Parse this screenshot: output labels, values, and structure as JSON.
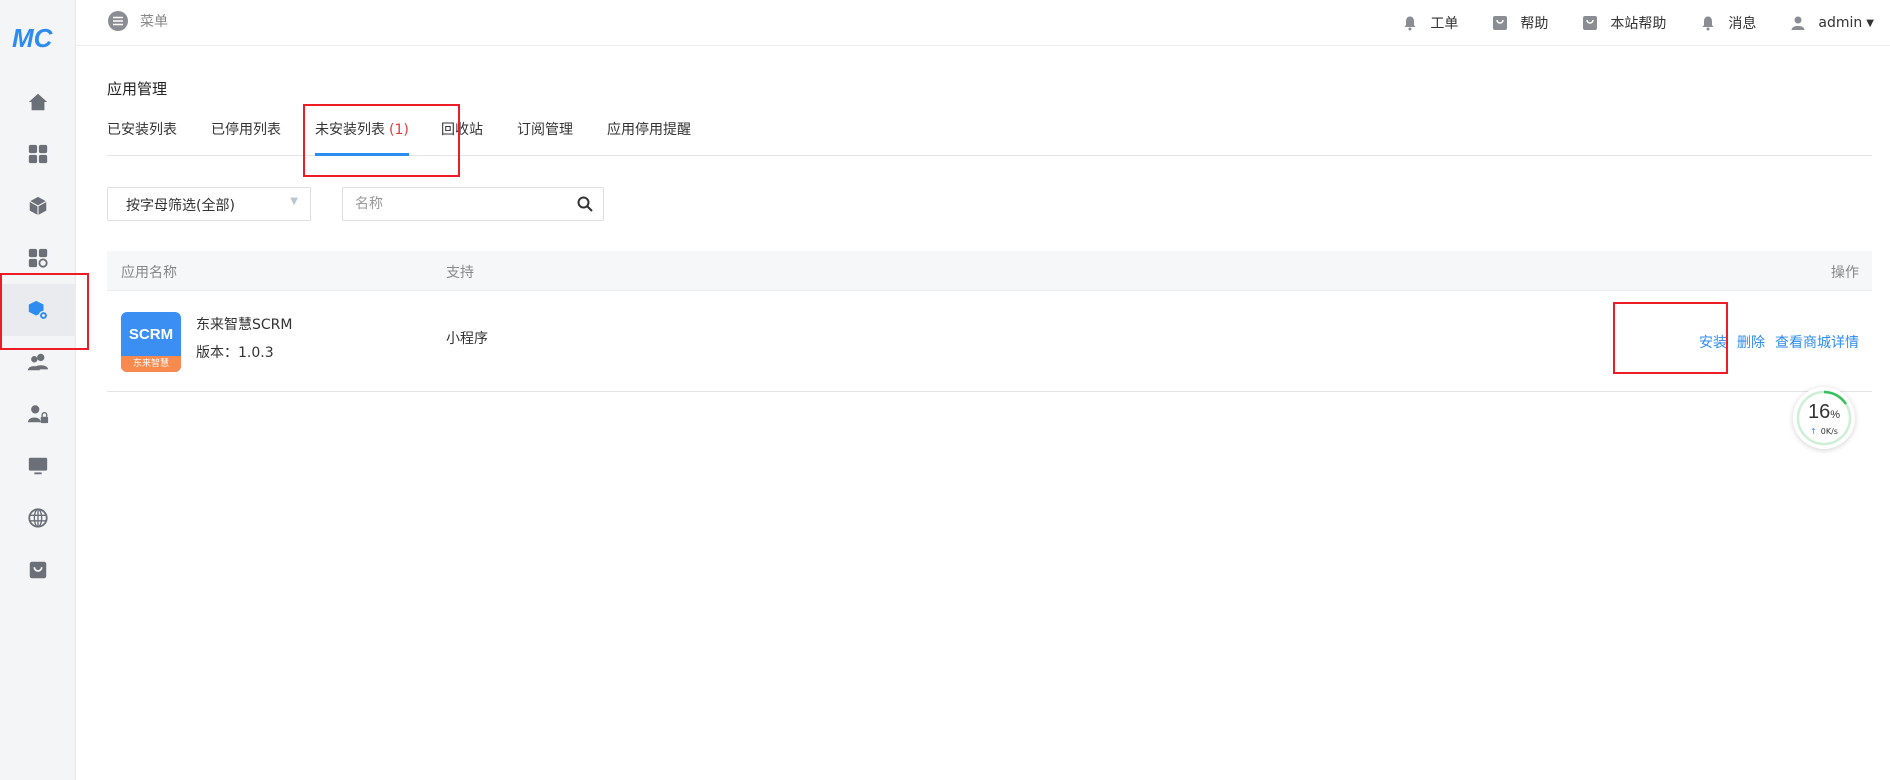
{
  "app": {
    "logo_text": "MC"
  },
  "topbar": {
    "menu_label": "菜单",
    "links": [
      {
        "label": "工单",
        "icon": "bell-icon"
      },
      {
        "label": "帮助",
        "icon": "bag-icon"
      },
      {
        "label": "本站帮助",
        "icon": "bag-icon"
      },
      {
        "label": "消息",
        "icon": "bell-icon"
      }
    ],
    "user": "admin"
  },
  "sidebar": {
    "items": [
      {
        "icon": "home-icon"
      },
      {
        "icon": "apps-grid-icon"
      },
      {
        "icon": "cube-icon"
      },
      {
        "icon": "apps-settings-icon"
      },
      {
        "icon": "app-manage-icon",
        "active": true
      },
      {
        "icon": "users-icon"
      },
      {
        "icon": "user-lock-icon"
      },
      {
        "icon": "monitor-icon"
      },
      {
        "icon": "globe-icon"
      },
      {
        "icon": "store-bag-icon"
      }
    ]
  },
  "page": {
    "title": "应用管理"
  },
  "tabs": [
    {
      "label": "已安装列表"
    },
    {
      "label": "已停用列表"
    },
    {
      "label": "未安装列表",
      "count": "(1)",
      "active": true
    },
    {
      "label": "回收站"
    },
    {
      "label": "订阅管理"
    },
    {
      "label": "应用停用提醒"
    }
  ],
  "filters": {
    "letter_select": "按字母筛选(全部)",
    "search_placeholder": "名称"
  },
  "table": {
    "headers": {
      "name": "应用名称",
      "support": "支持",
      "ops": "操作"
    },
    "rows": [
      {
        "icon_top": "SCRM",
        "icon_bottom": "东来智慧",
        "name": "东来智慧SCRM",
        "version": "版本：1.0.3",
        "support": "小程序",
        "actions": {
          "install": "安装",
          "delete": "删除",
          "details": "查看商城详情"
        }
      }
    ]
  },
  "speed_widget": {
    "percent": "16",
    "percent_unit": "%",
    "rate": "0K/s"
  },
  "colors": {
    "accent": "#2d8cf0",
    "highlight": "#ee1c25",
    "count": "#e03b3b"
  }
}
